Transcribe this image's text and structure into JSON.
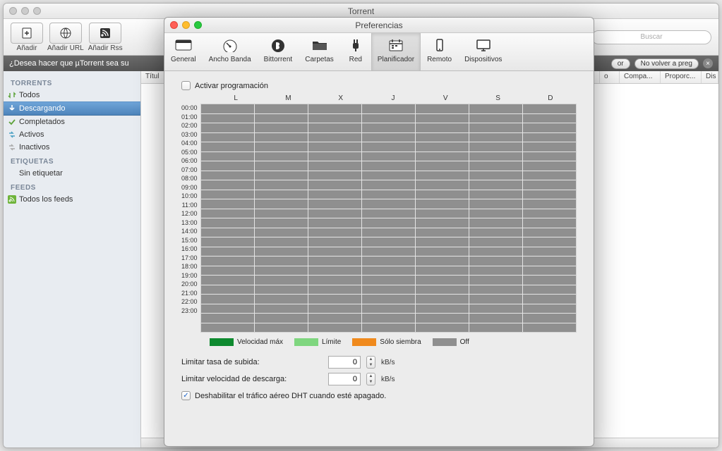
{
  "main_window": {
    "title": "Torrent",
    "toolbar": {
      "add": "Añadir",
      "add_url": "Añadir URL",
      "add_rss": "Añadir Rss",
      "search_placeholder": "Buscar"
    },
    "notice": {
      "text": "¿Desea hacer que µTorrent  sea su",
      "btn1": "or",
      "btn2": "No volver a preg"
    },
    "columns": [
      "Títul",
      "o",
      "Compa...",
      "Proporc...",
      "Dis"
    ],
    "sidebar": {
      "torrents_header": "TORRENTS",
      "items_torrents": [
        "Todos",
        "Descargando",
        "Completados",
        "Activos",
        "Inactivos"
      ],
      "selected_index": 1,
      "labels_header": "ETIQUETAS",
      "labels_item": "Sin etiquetar",
      "feeds_header": "FEEDS",
      "feeds_item": "Todos los feeds"
    }
  },
  "pref": {
    "title": "Preferencias",
    "tabs": [
      "General",
      "Ancho Banda",
      "Bittorrent",
      "Carpetas",
      "Red",
      "Planificador",
      "Remoto",
      "Dispositivos"
    ],
    "selected_tab": 5,
    "activate_label": "Activar programación",
    "days": [
      "L",
      "M",
      "X",
      "J",
      "V",
      "S",
      "D"
    ],
    "hours": [
      "00:00",
      "01:00",
      "02:00",
      "03:00",
      "04:00",
      "05:00",
      "06:00",
      "07:00",
      "08:00",
      "09:00",
      "10:00",
      "11:00",
      "12:00",
      "13:00",
      "14:00",
      "15:00",
      "16:00",
      "17:00",
      "18:00",
      "19:00",
      "20:00",
      "21:00",
      "22:00",
      "23:00"
    ],
    "legend": {
      "max": "Velocidad máx",
      "limit": "Límite",
      "seed": "Sólo siembra",
      "off": "Off"
    },
    "upload_label": "Limitar tasa de subida:",
    "download_label": "Limitar velocidad de descarga:",
    "upload_value": "0",
    "download_value": "0",
    "unit": "kB/s",
    "dht_label": "Deshabilitar el tráfico aéreo DHT cuando esté apagado.",
    "dht_checked": true
  }
}
